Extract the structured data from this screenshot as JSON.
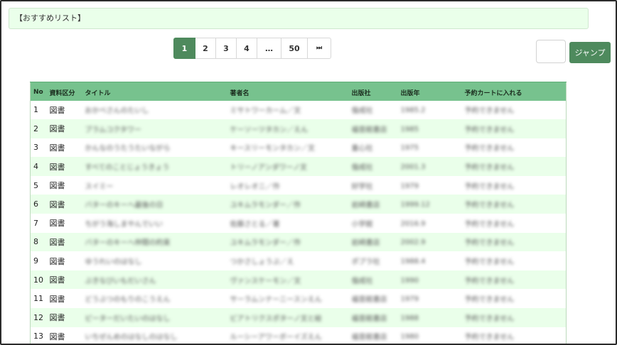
{
  "header": {
    "title": "【おすすめリスト】"
  },
  "pagination": {
    "pages": [
      "1",
      "2",
      "3",
      "4",
      "…",
      "50"
    ],
    "next_icon": "skip-to-end-icon",
    "next_glyph": "⏭",
    "current": "1"
  },
  "jump": {
    "input_value": "",
    "button_label": "ジャンプ"
  },
  "table": {
    "columns": [
      "No",
      "資料区分",
      "タイトル",
      "著者名",
      "出版社",
      "出版年",
      "予約カートに入れる"
    ],
    "rows": [
      {
        "no": "1",
        "type": "図書",
        "title": "おかべさんのたいし",
        "author": "ミサトワーカーム／文",
        "publisher": "偕成社",
        "year": "1985.2",
        "cart": "予約できません"
      },
      {
        "no": "2",
        "type": "図書",
        "title": "ブラムコクタワー",
        "author": "ケーソーツタカン／えん",
        "publisher": "福音館書店",
        "year": "1985",
        "cart": "予約できません"
      },
      {
        "no": "3",
        "type": "図書",
        "title": "かんなのうたうたいながら",
        "author": "キースリーモンタカン／文",
        "publisher": "童心社",
        "year": "1975",
        "cart": "予約できません"
      },
      {
        "no": "4",
        "type": "図書",
        "title": "すべてのことじょうきょう",
        "author": "トリーノアンダワーノ文",
        "publisher": "偕成社",
        "year": "2001.3",
        "cart": "予約できません"
      },
      {
        "no": "5",
        "type": "図書",
        "title": "スイミー",
        "author": "レオレオニ／作",
        "publisher": "好学社",
        "year": "1979",
        "cart": "予約できません"
      },
      {
        "no": "6",
        "type": "図書",
        "title": "バターのキーへ最後の日",
        "author": "ユキムラモンダー／作",
        "publisher": "岩崎書店",
        "year": "1999.12",
        "cart": "予約できません"
      },
      {
        "no": "7",
        "type": "図書",
        "title": "ちがう海しまやんでいい",
        "author": "佐藤さとる／著",
        "publisher": "小学館",
        "year": "2016.9",
        "cart": "予約できません"
      },
      {
        "no": "8",
        "type": "図書",
        "title": "バターのキーへ仲間の約束",
        "author": "ユキムラモンダー／作",
        "publisher": "岩崎書店",
        "year": "2002.9",
        "cart": "予約できません"
      },
      {
        "no": "9",
        "type": "図書",
        "title": "ゆうれいのはなし",
        "author": "つかさしょうぶ／え",
        "publisher": "ポプラ社",
        "year": "1988.4",
        "cart": "予約できません"
      },
      {
        "no": "10",
        "type": "図書",
        "title": "ぶきなびいもだいさん",
        "author": "ヴァンスケーモン／文",
        "publisher": "偕成社",
        "year": "1990",
        "cart": "予約できません"
      },
      {
        "no": "11",
        "type": "図書",
        "title": "どうぶつのもりのこうえん",
        "author": "サーラムンナーニースンえん",
        "publisher": "福音館書店",
        "year": "1979",
        "cart": "予約できません"
      },
      {
        "no": "12",
        "type": "図書",
        "title": "ピーターだいたいのはなし",
        "author": "ビアトリクスポターノ文と絵",
        "publisher": "福音館書店",
        "year": "1988",
        "cart": "予約できません"
      },
      {
        "no": "13",
        "type": "図書",
        "title": "いちぜんめのはなしのはなし",
        "author": "ルーシーアワーボーイズえん",
        "publisher": "福音館書店",
        "year": "1980",
        "cart": "予約できません"
      }
    ]
  }
}
